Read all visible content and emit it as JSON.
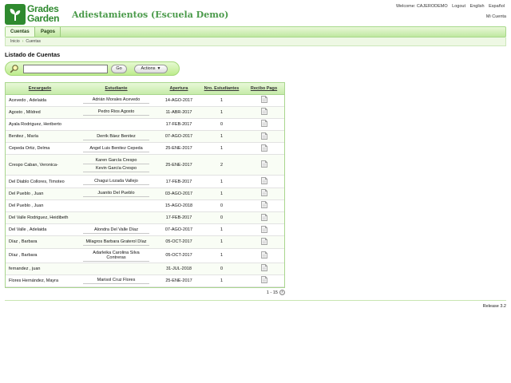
{
  "header": {
    "logo_line1": "Grades",
    "logo_line2": "Garden",
    "app_title": "Adiestamientos (Escuela Demo)",
    "welcome": "Welcome: CAJERODEMO",
    "logout": "Logout",
    "lang_en": "English",
    "lang_es": "Español",
    "my_account": "Mi Cuenta"
  },
  "nav": {
    "tabs": [
      {
        "label": "Cuentas"
      },
      {
        "label": "Pagos"
      }
    ],
    "breadcrumb": {
      "home": "Inicio",
      "sep": "›",
      "current": "Cuentas"
    }
  },
  "page": {
    "title": "Listado de Cuentas",
    "search_value": "",
    "go_label": "Go",
    "actions_label": "Actions"
  },
  "table": {
    "headers": [
      "Encargado",
      "Estudiante",
      "Apertura",
      "Nro. Estudiantes",
      "Recibo Pago"
    ],
    "rows": [
      {
        "encargado": "Acevedo , Adelaida",
        "estudiantes": [
          "Adrián Morales Acevedo"
        ],
        "apertura": "14-AGO-2017",
        "num": "1"
      },
      {
        "encargado": "Agosto , Mildred",
        "estudiantes": [
          "Pedro Rios Agosto"
        ],
        "apertura": "11-ABR-2017",
        "num": "1"
      },
      {
        "encargado": "Ayala Rodriguez, Heriberto",
        "estudiantes": [],
        "apertura": "17-FEB-2017",
        "num": "0"
      },
      {
        "encargado": "Benitez , María",
        "estudiantes": [
          "Derrik Báez Benitez"
        ],
        "apertura": "07-AGO-2017",
        "num": "1"
      },
      {
        "encargado": "Cepeda Ortiz, Delma",
        "estudiantes": [
          "Angel Luis Benitez Cepeda"
        ],
        "apertura": "25-ENE-2017",
        "num": "1"
      },
      {
        "encargado": "Crespo Caban, Veronica-",
        "estudiantes": [
          "Karen García Crespo",
          "Kevin García Crespo"
        ],
        "apertura": "25-ENE-2017",
        "num": "2"
      },
      {
        "encargado": "Del Diablo Collores, Timoteo",
        "estudiantes": [
          "Chagui Lozada Vallejo"
        ],
        "apertura": "17-FEB-2017",
        "num": "1"
      },
      {
        "encargado": "Del Pueblo , Juan",
        "estudiantes": [
          "Juanito Del Pueblo"
        ],
        "apertura": "03-AGO-2017",
        "num": "1"
      },
      {
        "encargado": "Del Pueblo , Juan",
        "estudiantes": [],
        "apertura": "15-AGO-2018",
        "num": "0"
      },
      {
        "encargado": "Del Valle Rodriguez, Heidibeth",
        "estudiantes": [],
        "apertura": "17-FEB-2017",
        "num": "0"
      },
      {
        "encargado": "Del Valle , Adelaida",
        "estudiantes": [
          "Alondra Del Valle Díaz"
        ],
        "apertura": "07-AGO-2017",
        "num": "1"
      },
      {
        "encargado": "Díaz , Barbara",
        "estudiantes": [
          "Milagros Barbara Graterol Díaz"
        ],
        "apertura": "05-OCT-2017",
        "num": "1"
      },
      {
        "encargado": "Díaz , Barbara",
        "estudiantes": [
          "Adarleika Carolina Silva Contreras"
        ],
        "apertura": "05-OCT-2017",
        "num": "1"
      },
      {
        "encargado": "fernandez , juan",
        "estudiantes": [],
        "apertura": "31-JUL-2018",
        "num": "0"
      },
      {
        "encargado": "Flores Hernández, Mayra",
        "estudiantes": [
          "Marisol Cruz Flores"
        ],
        "apertura": "25-ENE-2017",
        "num": "1"
      }
    ]
  },
  "pager": {
    "range": "1 - 15",
    "next_icon": "arrow-right-icon"
  },
  "footer": {
    "release": "Release 3.2"
  },
  "colors": {
    "brand": "#2f8a2f",
    "nav_bg": "#bfe8a0",
    "title": "#4a9a4a"
  }
}
